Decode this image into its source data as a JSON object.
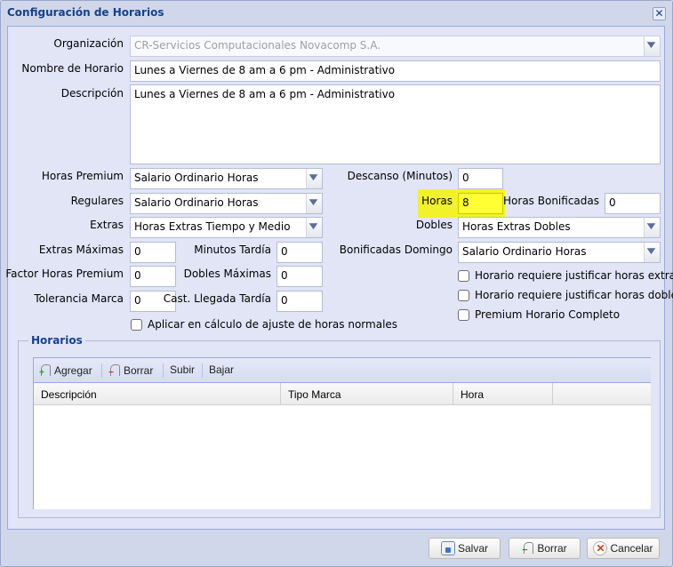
{
  "window": {
    "title": "Configuración de Horarios",
    "close_icon": "close-icon"
  },
  "form": {
    "organizacion": {
      "label": "Organización",
      "value": "CR-Servicios Computacionales Novacomp S.A."
    },
    "nombre_horario": {
      "label": "Nombre de Horario",
      "value": "Lunes a Viernes de 8 am a 6 pm - Administrativo"
    },
    "descripcion": {
      "label": "Descripción",
      "value": "Lunes a Viernes de 8 am a 6 pm - Administrativo"
    },
    "horas_premium": {
      "label": "Horas Premium",
      "value": "Salario Ordinario Horas"
    },
    "regulares": {
      "label": "Regulares",
      "value": "Salario Ordinario Horas"
    },
    "extras": {
      "label": "Extras",
      "value": "Horas Extras Tiempo y Medio"
    },
    "extras_maximas": {
      "label": "Extras Máximas",
      "value": "0"
    },
    "minutos_tardia": {
      "label": "Minutos Tardía",
      "value": "0"
    },
    "factor_horas_premium": {
      "label": "Factor Horas Premium",
      "value": "0"
    },
    "dobles_maximas": {
      "label": "Dobles Máximas",
      "value": "0"
    },
    "tolerancia_marca": {
      "label": "Tolerancia Marca",
      "value": "0"
    },
    "cast_llegada_tardia": {
      "label": "Cast. Llegada Tardía",
      "value": "0"
    },
    "aplicar_calculo": {
      "label": "Aplicar en cálculo de ajuste de horas normales",
      "checked": false
    },
    "descanso": {
      "label": "Descanso (Minutos)",
      "value": "0"
    },
    "horas": {
      "label": "Horas",
      "value": "8",
      "highlight_color": "#ffff33"
    },
    "horas_bonificadas": {
      "label": "Horas Bonificadas",
      "value": "0"
    },
    "dobles": {
      "label": "Dobles",
      "value": "Horas Extras Dobles"
    },
    "bonificadas_domingo": {
      "label": "Bonificadas Domingo",
      "value": "Salario Ordinario Horas"
    },
    "justificar_extras": {
      "label": "Horario requiere justificar horas extras",
      "checked": false
    },
    "justificar_dobles": {
      "label": "Horario requiere justificar horas dobles",
      "checked": false
    },
    "premium_completo": {
      "label": "Premium Horario Completo",
      "checked": false
    }
  },
  "horarios": {
    "legend": "Horarios",
    "toolbar": {
      "agregar": "Agregar",
      "borrar": "Borrar",
      "subir": "Subir",
      "bajar": "Bajar"
    },
    "columns": [
      "Descripción",
      "Tipo Marca",
      "Hora",
      ""
    ],
    "rows": []
  },
  "footer": {
    "salvar": "Salvar",
    "borrar": "Borrar",
    "cancelar": "Cancelar"
  },
  "colors": {
    "title": "#15428b",
    "panel_bg": "#e1e5f6",
    "frame_bg": "#d1d7ea"
  }
}
